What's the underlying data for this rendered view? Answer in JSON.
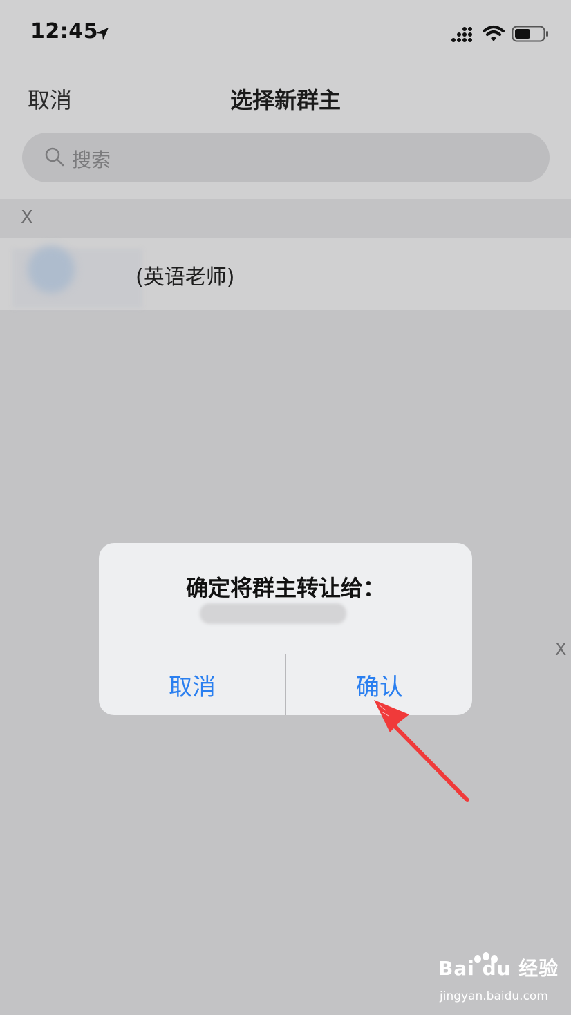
{
  "status_bar": {
    "time": "12:45"
  },
  "nav": {
    "cancel_label": "取消",
    "title": "选择新群主"
  },
  "search": {
    "placeholder": "搜索"
  },
  "section": {
    "letter": "X"
  },
  "contact": {
    "name_suffix": "(英语老师)"
  },
  "index": {
    "letter": "X"
  },
  "dialog": {
    "title": "确定将群主转让给：",
    "cancel_label": "取消",
    "confirm_label": "确认"
  },
  "watermark": {
    "brand": "Bai du 经验",
    "url": "jingyan.baidu.com"
  },
  "colors": {
    "accent": "#2a7ff0",
    "annotation": "#f03a3a"
  }
}
